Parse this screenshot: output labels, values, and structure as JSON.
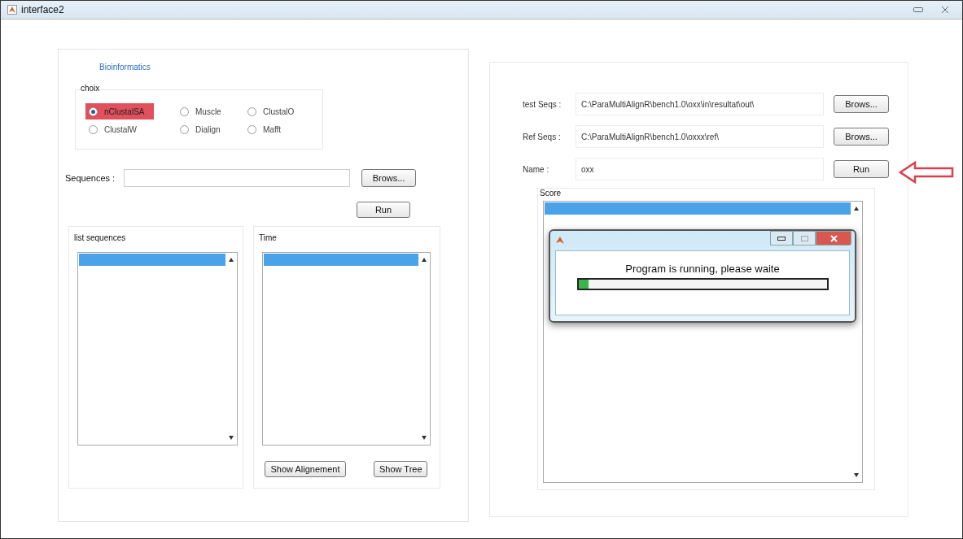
{
  "window": {
    "title": "interface2"
  },
  "left_panel": {
    "title": "Bioinformatics",
    "choice": {
      "label": "choix",
      "options": [
        {
          "label": "nClustalSA",
          "selected": true
        },
        {
          "label": "Muscle",
          "selected": false
        },
        {
          "label": "ClustalO",
          "selected": false
        },
        {
          "label": "ClustalW",
          "selected": false
        },
        {
          "label": "Dialign",
          "selected": false
        },
        {
          "label": "Mafft",
          "selected": false
        }
      ]
    },
    "sequences": {
      "label": "Sequences :",
      "button": "Brows..."
    },
    "run_button": "Run",
    "lists": [
      {
        "label": "list sequences"
      },
      {
        "label": "Time"
      }
    ],
    "buttons": [
      "Show Alignement",
      "Show Tree"
    ]
  },
  "right_panel": {
    "fields": [
      {
        "label": "test Seqs :",
        "value": "C:\\ParaMultiAlignR\\bench1.0\\oxx\\in\\resultat\\out\\",
        "button": "Brows..."
      },
      {
        "label": "Ref Seqs :",
        "value": "C:\\ParaMultiAlignR\\bench1.0\\oxxx\\ref\\",
        "button": "Brows..."
      },
      {
        "label": "Name :",
        "value": "oxx",
        "button": "Run"
      }
    ],
    "score": {
      "label": "Score"
    }
  },
  "dialog": {
    "message": "Program is running, please waite",
    "level": 0.04
  }
}
